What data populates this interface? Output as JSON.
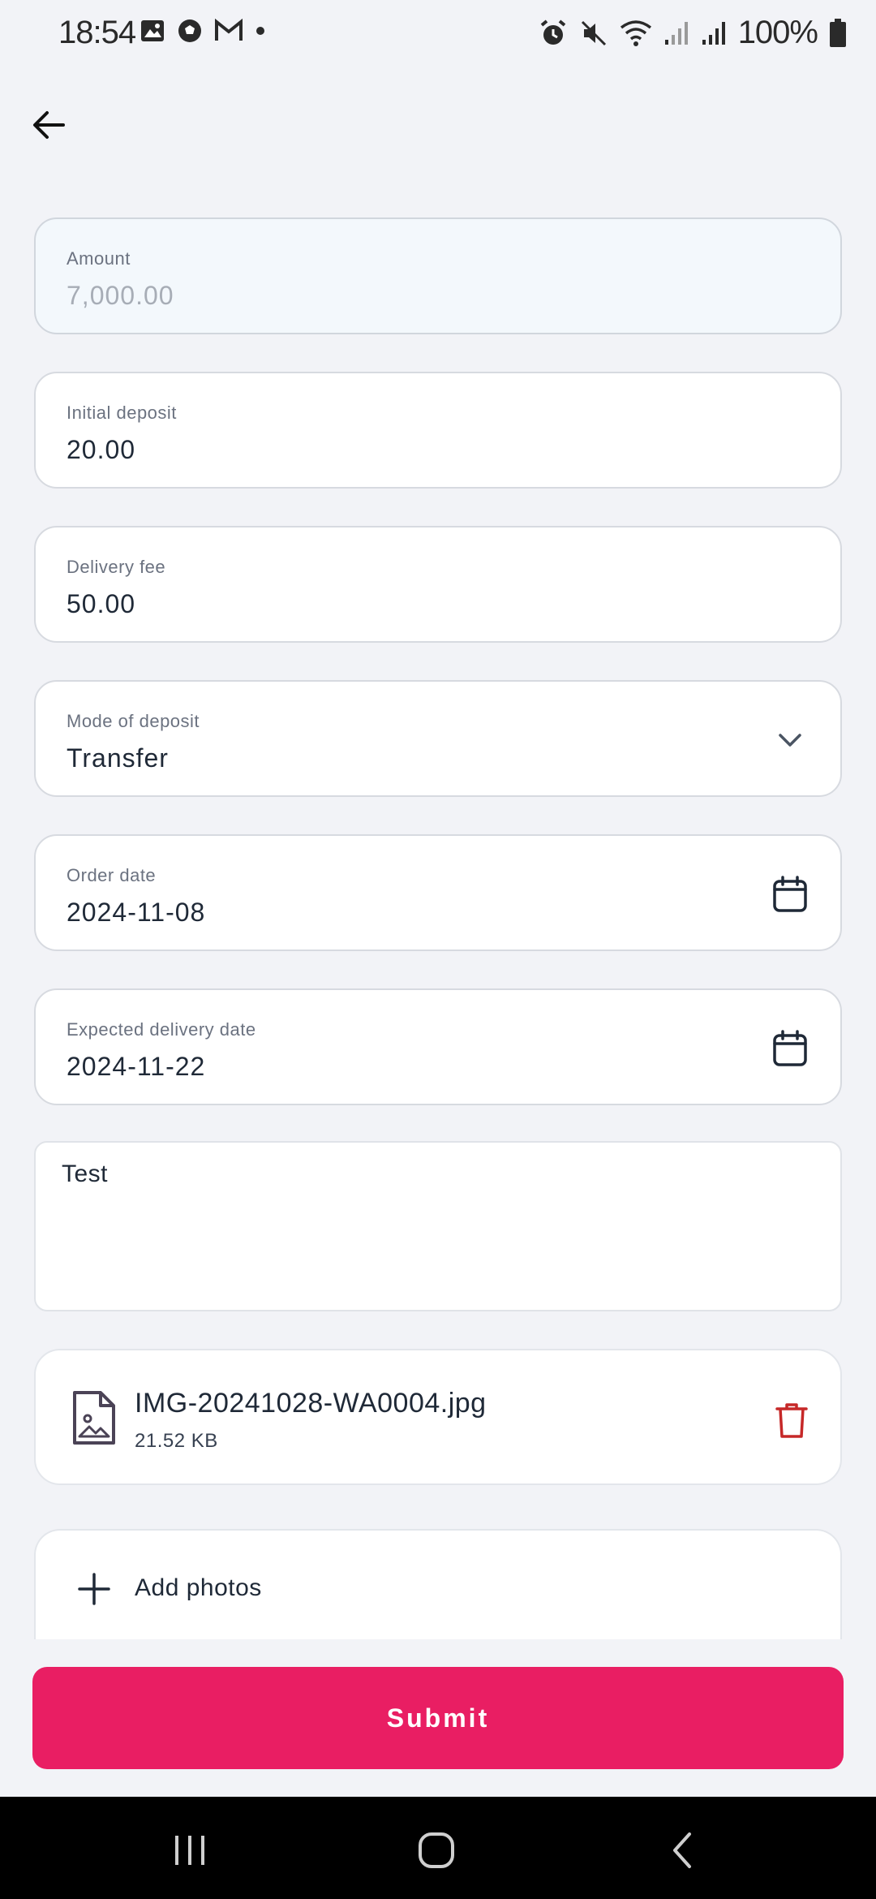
{
  "status_bar": {
    "time": "18:54",
    "battery": "100%",
    "left_icons": [
      "gallery-icon",
      "football-icon",
      "gmail-icon",
      "dot-icon"
    ],
    "right_icons": [
      "alarm-icon",
      "mute-icon",
      "wifi-icon",
      "signal-icon",
      "signal-icon",
      "battery-icon"
    ]
  },
  "header": {
    "back_icon": "arrow-left-icon"
  },
  "form": {
    "amount": {
      "label": "Amount",
      "value": "7,000.00"
    },
    "initial_deposit": {
      "label": "Initial deposit",
      "value": "20.00"
    },
    "delivery_fee": {
      "label": "Delivery fee",
      "value": "50.00"
    },
    "mode_of_deposit": {
      "label": "Mode of deposit",
      "value": "Transfer"
    },
    "order_date": {
      "label": "Order date",
      "value": "2024-11-08"
    },
    "expected_delivery_date": {
      "label": "Expected delivery date",
      "value": "2024-11-22"
    },
    "notes": {
      "value": "Test"
    }
  },
  "attachment": {
    "name": "IMG-20241028-WA0004.jpg",
    "size": "21.52 KB"
  },
  "add_photos": {
    "label": "Add photos"
  },
  "submit": {
    "label": "Submit"
  },
  "colors": {
    "accent": "#e91e63",
    "delete": "#c62828",
    "background": "#f2f3f7"
  }
}
